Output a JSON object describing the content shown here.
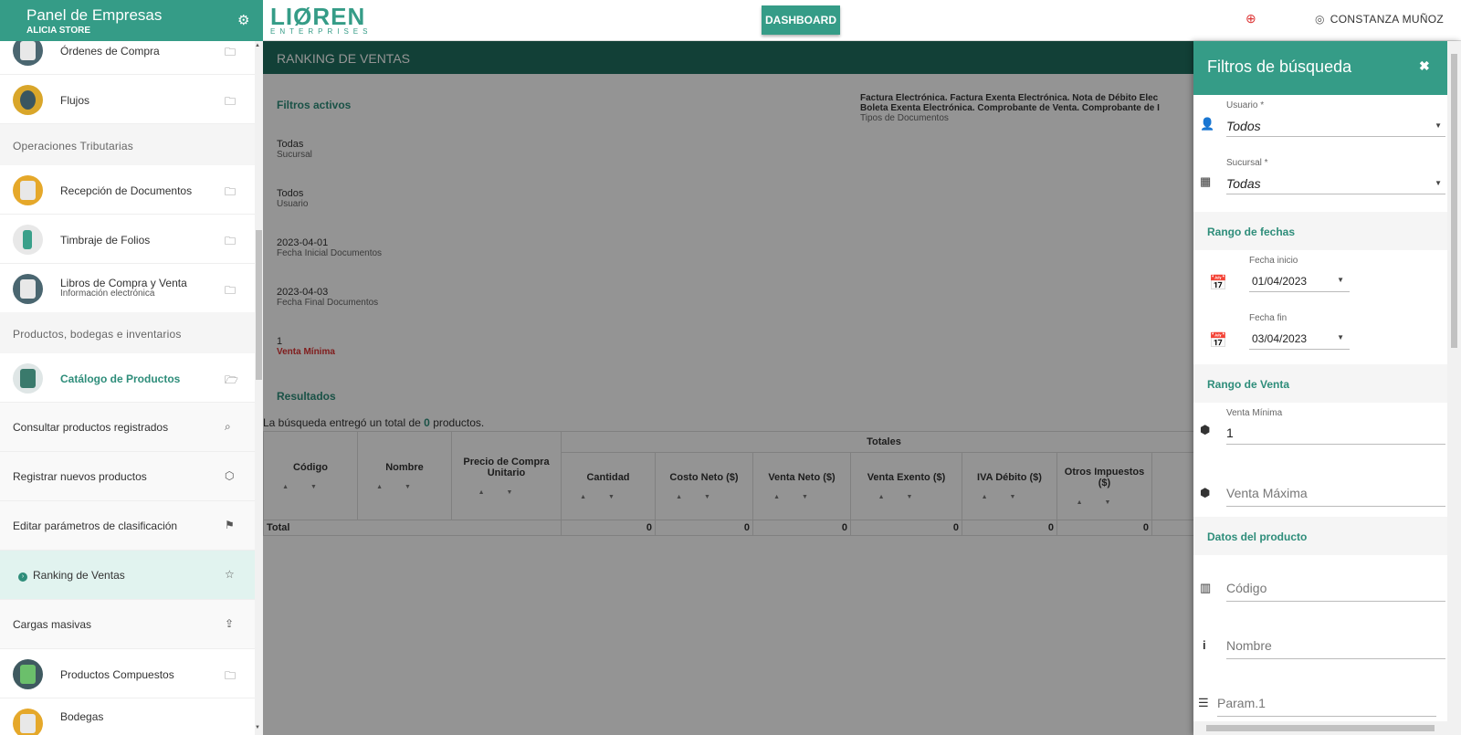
{
  "sidebar": {
    "title": "Panel de Empresas",
    "subtitle": "ALICIA STORE",
    "items": [
      {
        "label": "Órdenes de Compra"
      },
      {
        "label": "Flujos"
      },
      {
        "section": "Operaciones Tributarias"
      },
      {
        "label": "Recepción de Documentos"
      },
      {
        "label": "Timbraje de Folios"
      },
      {
        "label": "Libros de Compra y Venta",
        "sub": "Información electrónica"
      },
      {
        "section": "Productos, bodegas e inventarios"
      },
      {
        "label": "Catálogo de Productos"
      },
      {
        "label": "Consultar productos registrados"
      },
      {
        "label": "Registrar nuevos productos"
      },
      {
        "label": "Editar parámetros de clasificación"
      },
      {
        "label": "Ranking de Ventas"
      },
      {
        "label": "Cargas masivas"
      },
      {
        "label": "Productos Compuestos"
      },
      {
        "label": "Bodegas"
      }
    ]
  },
  "topbar": {
    "logo_main": "LIØREN",
    "logo_sub": "ENTERPRISES",
    "dashboard": "DASHBOARD",
    "user": "CONSTANZA MUÑOZ"
  },
  "main": {
    "title": "RANKING DE VENTAS",
    "filters_title": "Filtros activos",
    "active_filters": [
      {
        "value": "Todas",
        "label": "Sucursal"
      },
      {
        "value": "Todos",
        "label": "Usuario"
      },
      {
        "value": "2023-04-01",
        "label": "Fecha Inicial Documentos"
      },
      {
        "value": "2023-04-03",
        "label": "Fecha Final Documentos"
      },
      {
        "value": "1",
        "label": "Venta Mínima"
      }
    ],
    "doc_types_line1": "Factura Electrónica. Factura Exenta Electrónica. Nota de Débito Elec",
    "doc_types_line2": "Boleta Exenta Electrónica. Comprobante de Venta. Comprobante de I",
    "doc_types_label": "Tipos de Documentos",
    "results_title": "Resultados",
    "result_prefix": "La búsqueda entregó un total de",
    "result_count": "0",
    "result_suffix": "productos.",
    "table": {
      "group_header": "Totales",
      "headers": [
        "Código",
        "Nombre",
        "Precio de Compra Unitario",
        "Cantidad",
        "Costo Neto ($)",
        "Venta Neto ($)",
        "Venta Exento ($)",
        "IVA Débito ($)",
        "Otros Impuestos ($)"
      ],
      "total_label": "Total",
      "totals": [
        "0",
        "0",
        "0",
        "0",
        "0",
        "0"
      ]
    }
  },
  "panel": {
    "title": "Filtros de búsqueda",
    "usuario_label": "Usuario *",
    "usuario_value": "Todos",
    "sucursal_label": "Sucursal *",
    "sucursal_value": "Todas",
    "fechas_section": "Rango de fechas",
    "fecha_inicio_label": "Fecha inicio",
    "fecha_inicio_value": "01/04/2023",
    "fecha_fin_label": "Fecha fin",
    "fecha_fin_value": "03/04/2023",
    "venta_section": "Rango de Venta",
    "venta_min_label": "Venta Mínima",
    "venta_min_value": "1",
    "venta_max_placeholder": "Venta Máxima",
    "producto_section": "Datos del producto",
    "codigo_placeholder": "Código",
    "nombre_placeholder": "Nombre",
    "param1_placeholder": "Param.1"
  },
  "colors": {
    "accent": "#359c87",
    "header_dark": "#1f6f5f",
    "warning": "#d33"
  }
}
